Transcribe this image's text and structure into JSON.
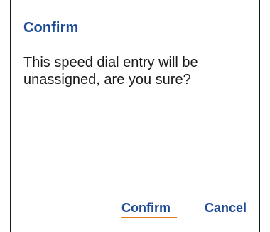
{
  "dialog": {
    "title": "Confirm",
    "message": "This speed dial entry will be unassigned, are you sure?",
    "buttons": {
      "confirm_label": "Confirm",
      "cancel_label": "Cancel"
    },
    "colors": {
      "accent": "#1c4a96",
      "focus": "#e07a1f",
      "text": "#1a1a1a",
      "background": "#ffffff"
    }
  }
}
